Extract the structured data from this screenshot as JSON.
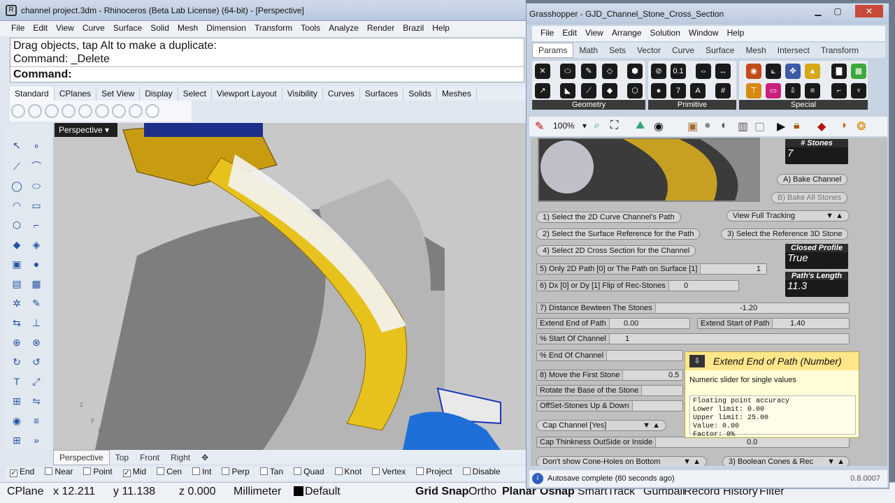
{
  "rhino": {
    "title": "channel project.3dm - Rhinoceros (Beta Lab License) (64-bit) - [Perspective]",
    "menu": [
      "File",
      "Edit",
      "View",
      "Curve",
      "Surface",
      "Solid",
      "Mesh",
      "Dimension",
      "Transform",
      "Tools",
      "Analyze",
      "Render",
      "Brazil",
      "Help"
    ],
    "command_history": [
      "Drag objects, tap Alt to make a duplicate:",
      "Command: _Delete"
    ],
    "command_prompt": "Command:",
    "toolbar_tabs": [
      "Standard",
      "CPlanes",
      "Set View",
      "Display",
      "Select",
      "Viewport Layout",
      "Visibility",
      "Curves",
      "Surfaces",
      "Solids",
      "Meshes"
    ],
    "viewport_title": "Perspective",
    "viewport_tabs": [
      "Perspective",
      "Top",
      "Front",
      "Right"
    ],
    "axis_labels": {
      "z": "z",
      "y": "y",
      "x": "x"
    },
    "osnaps": [
      {
        "label": "End",
        "checked": true
      },
      {
        "label": "Near",
        "checked": false
      },
      {
        "label": "Point",
        "checked": false
      },
      {
        "label": "Mid",
        "checked": true
      },
      {
        "label": "Cen",
        "checked": false
      },
      {
        "label": "Int",
        "checked": false
      },
      {
        "label": "Perp",
        "checked": false
      },
      {
        "label": "Tan",
        "checked": false
      },
      {
        "label": "Quad",
        "checked": false
      },
      {
        "label": "Knot",
        "checked": false
      },
      {
        "label": "Vertex",
        "checked": false
      },
      {
        "label": "Project",
        "checked": false
      },
      {
        "label": "Disable",
        "checked": false
      }
    ],
    "status": {
      "cplane": "CPlane",
      "x": "x 12.211",
      "y": "y 11.138",
      "z": "z 0.000",
      "units": "Millimeter",
      "layer": "Default",
      "panes": [
        "Grid Snap",
        "Ortho",
        "Planar",
        "Osnap",
        "SmartTrack",
        "Gumball",
        "Record History",
        "Filter"
      ]
    }
  },
  "gh": {
    "title": "Grasshopper - GJD_Channel_Stone_Cross_Section",
    "menu": [
      "File",
      "Edit",
      "View",
      "Arrange",
      "Solution",
      "Window",
      "Help"
    ],
    "tabs": [
      "Params",
      "Math",
      "Sets",
      "Vector",
      "Curve",
      "Surface",
      "Mesh",
      "Intersect",
      "Transform"
    ],
    "groups": [
      "Geometry",
      "Primitive",
      "Special"
    ],
    "zoom": "100%",
    "panels": {
      "stones": {
        "title": "# Stones",
        "value": "7"
      },
      "closed": {
        "title": "Closed Profile",
        "value": "True"
      },
      "length": {
        "title": "Path's Length",
        "value": "11.3"
      }
    },
    "buttons": {
      "bake_channel": "A) Bake Channel",
      "bake_stones": "B) Bake All Stones",
      "select_path": "1) Select the 2D Curve Channel's Path",
      "tracking": "View Full Tracking",
      "select_surface": "2) Select the Surface Reference for the Path",
      "select_stone": "3) Select the Reference 3D Stone",
      "select_cross": "4) Select 2D Cross Section for the Channel",
      "cap_channel": "Cap Channel [Yes]",
      "cone_holes": "Don't show Cone-Holes on Bottom",
      "boolean": "3) Boolean Cones & Rec"
    },
    "sliders": {
      "only2d": {
        "label": "5) Only 2D Path [0] or The Path on Surface [1]",
        "value": "1"
      },
      "dxdy": {
        "label": "6) Dx [0] or Dy [1] Flip of Rec-Stones",
        "value": "0"
      },
      "distance": {
        "label": "7) Distance Bewteen The Stones",
        "value": "-1.20"
      },
      "extend_end": {
        "label": "Extend End of Path",
        "value": "0.00"
      },
      "extend_start": {
        "label": "Extend Start of Path",
        "value": "1.40"
      },
      "start_channel": {
        "label": "% Start Of Channel",
        "value": "1"
      },
      "end_channel": {
        "label": "% End Of Channel",
        "value": ""
      },
      "move_first": {
        "label": "8) Move the First Stone",
        "value": "0.5"
      },
      "rotate_base": {
        "label": "Rotate the Base of the Stone",
        "value": ""
      },
      "offset_stones": {
        "label": "OffSet-Stones Up & Down",
        "value": ""
      },
      "cap_thickness": {
        "label": "Cap Thinkness OutSide or Inside",
        "value": "0.0"
      }
    },
    "tooltip": {
      "title": "Extend End of Path (Number)",
      "description": "Numeric slider for single values",
      "details": [
        "Floating point accuracy",
        "Lower limit: 0.00",
        "Upper limit: 25.00",
        "Value: 0.00",
        "Factor: 0%"
      ]
    },
    "status_text": "Autosave complete (80 seconds ago)",
    "version": "0.8.0007"
  },
  "colors": {
    "gold": "#e8c21c",
    "viewport_bg": "#cfcfcf",
    "gh_canvas": "#bfbfbf",
    "tooltip_bg": "#fffcd6"
  }
}
